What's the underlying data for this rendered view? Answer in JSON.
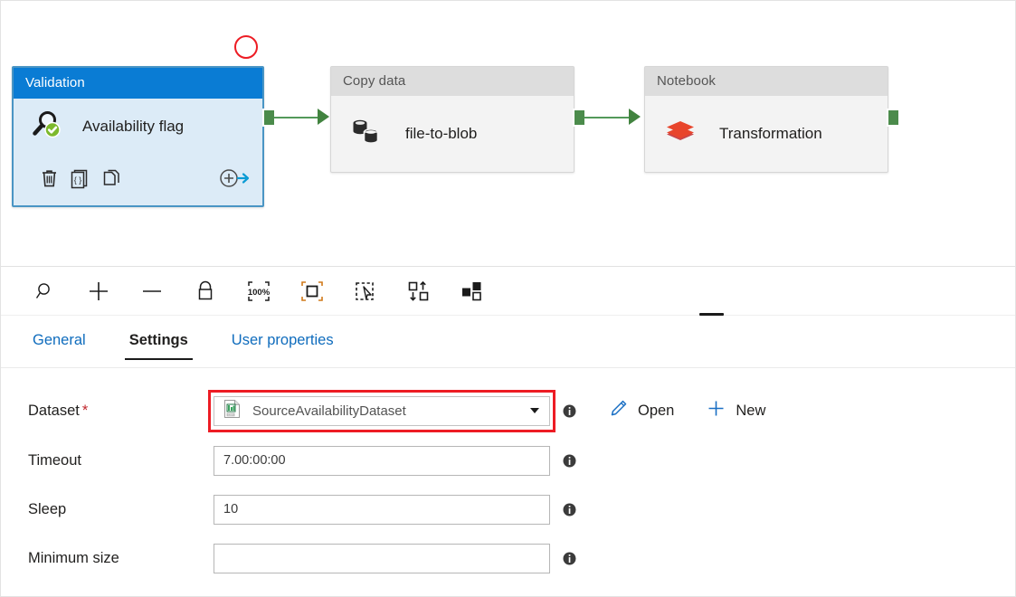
{
  "canvas": {
    "annotation": {
      "shape": "circle",
      "color": "#ed1c24"
    },
    "nodes": [
      {
        "type_label": "Validation",
        "name": "Availability flag",
        "icon": "validation-magnifier-check-icon",
        "selected": true,
        "actions": [
          {
            "label": "Delete",
            "icon": "trash-icon"
          },
          {
            "label": "Code",
            "icon": "code-braces-icon"
          },
          {
            "label": "Clone",
            "icon": "copy-pages-icon"
          },
          {
            "label": "Add output",
            "icon": "add-arrow-icon"
          }
        ]
      },
      {
        "type_label": "Copy data",
        "name": "file-to-blob",
        "icon": "database-copy-icon",
        "selected": false,
        "actions": []
      },
      {
        "type_label": "Notebook",
        "name": "Transformation",
        "icon": "databricks-stack-icon",
        "selected": false,
        "actions": []
      }
    ],
    "connectors": [
      {
        "from": "Validation",
        "to": "Copy data"
      },
      {
        "from": "Copy data",
        "to": "Notebook"
      },
      {
        "from": "Notebook",
        "to": ""
      }
    ]
  },
  "toolbar": {
    "buttons": [
      {
        "label": "Search",
        "icon": "search-icon"
      },
      {
        "label": "Zoom in",
        "icon": "plus-icon"
      },
      {
        "label": "Zoom out",
        "icon": "minus-icon"
      },
      {
        "label": "Lock canvas",
        "icon": "lock-icon"
      },
      {
        "label": "Zoom to 100%",
        "icon": "zoom-100-percent-icon",
        "icon_text": "100%"
      },
      {
        "label": "Zoom to fit",
        "icon": "zoom-to-fit-icon"
      },
      {
        "label": "Marquee select",
        "icon": "marquee-select-icon"
      },
      {
        "label": "Auto align",
        "icon": "auto-align-icon"
      },
      {
        "label": "Arrange",
        "icon": "arrange-nodes-icon"
      }
    ],
    "drag_handle": "panel-resize-handle"
  },
  "tabs": [
    {
      "label": "General",
      "active": false
    },
    {
      "label": "Settings",
      "active": true
    },
    {
      "label": "User properties",
      "active": false
    }
  ],
  "settings": {
    "fields": [
      {
        "label": "Dataset",
        "required": true,
        "control": "combo",
        "value": "SourceAvailabilityDataset",
        "placeholder": "",
        "icon": "csv-dataset-icon",
        "highlighted": true
      },
      {
        "label": "Timeout",
        "required": false,
        "control": "text",
        "value": "7.00:00:00",
        "placeholder": "",
        "highlighted": false
      },
      {
        "label": "Sleep",
        "required": false,
        "control": "text",
        "value": "10",
        "placeholder": "",
        "highlighted": false
      },
      {
        "label": "Minimum size",
        "required": false,
        "control": "text",
        "value": "",
        "placeholder": "",
        "highlighted": false
      }
    ],
    "dataset_actions": [
      {
        "label": "Open",
        "icon": "pencil-edit-icon"
      },
      {
        "label": "New",
        "icon": "plus-icon"
      }
    ]
  },
  "colors": {
    "accent_blue": "#0a7cd4",
    "link_blue": "#0f6cbd",
    "connector_green": "#4b8b4b",
    "annotation_red": "#ed1c24",
    "required_red": "#c1272d",
    "notebook_red": "#e8452c"
  }
}
